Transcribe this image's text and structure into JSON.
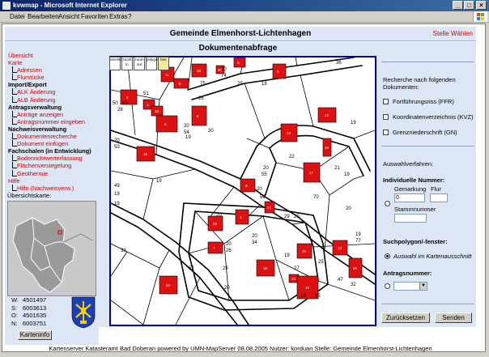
{
  "window": {
    "title": "kvwmap - Microsoft Internet Explorer"
  },
  "menu": [
    "Datei",
    "Bearbeiten",
    "Ansicht",
    "Favoriten",
    "Extras",
    "?"
  ],
  "header": {
    "title": "Gemeinde Elmenhorst-Lichtenhagen",
    "stelle_link": "Stelle Wählen"
  },
  "nav": [
    {
      "label": "Übersicht",
      "level": "l0"
    },
    {
      "label": "Karte",
      "level": "l0"
    },
    {
      "label": "Adressen",
      "level": "l1"
    },
    {
      "label": "Flurstücke",
      "level": "l1"
    },
    {
      "label": "Import/Export",
      "level": "l0b"
    },
    {
      "label": "ALK Änderung",
      "level": "l1"
    },
    {
      "label": "ALB Änderung",
      "level": "l1"
    },
    {
      "label": "Antragsverwaltung",
      "level": "l0b"
    },
    {
      "label": "Anträge anzeigen",
      "level": "l1"
    },
    {
      "label": "Antragsnummer eingeben",
      "level": "l1"
    },
    {
      "label": "Nachweisverwaltung",
      "level": "l0b"
    },
    {
      "label": "Dokumentenrecherche",
      "level": "l1"
    },
    {
      "label": "Dokument einfügen",
      "level": "l1"
    },
    {
      "label": "Fachschalen (in Entwicklung)",
      "level": "l0b"
    },
    {
      "label": "Bodenrichtwerterfassung",
      "level": "l1"
    },
    {
      "label": "Flächenversiegelung",
      "level": "l1"
    },
    {
      "label": "Geothermie",
      "level": "l1"
    },
    {
      "label": "Hilfe",
      "level": "l0"
    },
    {
      "label": "Hilfe (Nachweisverw.)",
      "level": "l1"
    }
  ],
  "overview": {
    "label": "Übersichtskarte:"
  },
  "coords": [
    {
      "key": "W:",
      "value": "4501497"
    },
    {
      "key": "S:",
      "value": "6003613"
    },
    {
      "key": "O:",
      "value": "4501635"
    },
    {
      "key": "N:",
      "value": "6003751"
    }
  ],
  "kartenifo_button": "Karteninfo",
  "map": {
    "title": "Dokumentenabfrage",
    "tools": [
      "recentr",
      "zoom in",
      "zoom out",
      "polygon",
      "box"
    ],
    "parcel_labels": [
      "20",
      "74",
      "25",
      "18",
      "75",
      "51",
      "50",
      "49",
      "26",
      "20",
      "54",
      "19",
      "28",
      "20",
      "53",
      "19",
      "30",
      "20",
      "55",
      "20",
      "56",
      "20",
      "21",
      "19",
      "70",
      "20",
      "22",
      "29",
      "20",
      "36",
      "19",
      "19",
      "49",
      "19",
      "47",
      "32",
      "33",
      "20",
      "26",
      "29",
      "57",
      "20",
      "25",
      "19",
      "27",
      "19",
      "65",
      "20",
      "34",
      "19",
      "77"
    ],
    "house_numbers": [
      "4",
      "1",
      "11",
      "6",
      "18",
      "8",
      "10",
      "5",
      "30",
      "8",
      "9",
      "12",
      "20",
      "14",
      "17",
      "3",
      "21",
      "15",
      "22",
      "13",
      "24",
      "19",
      "16",
      "25",
      "7",
      "2",
      "23",
      "26"
    ]
  },
  "panel": {
    "intro": "Recherche nach folgenden Dokumenten:",
    "doc_types": [
      "Fortführungsriss (FFR)",
      "Koordinatenverzeichnis (KVZ)",
      "Grenzniederschrift (GN)"
    ],
    "auswahlverfahren": "Auswahlverfahren:",
    "individuelle": "Individuelle Nummer:",
    "gemarkung_label": "Gemarkung",
    "flur_label": "Flur",
    "gemarkung_value": "0",
    "stammnummer_label": "Stammnummer",
    "suchpolygon": "Suchpolygon/-fenster:",
    "auswahl_option": "Auswahl im Kartenausschnitt",
    "antragsnummer": "Antragsnummer:",
    "reset_button": "Zurücksetzen",
    "send_button": "Senden"
  },
  "footer": "Kartenserver Katasteramt Bad Doberan powered by UMN-MapServer 08.08.2005 Nutzer: korduan Stelle: Gemeinde Elmenhorst-Lichtenhagen",
  "colors": {
    "building": "#dd1111",
    "nav_link": "#cc0000",
    "panel_bg": "#dde6f5",
    "map_border": "#0000a0"
  }
}
